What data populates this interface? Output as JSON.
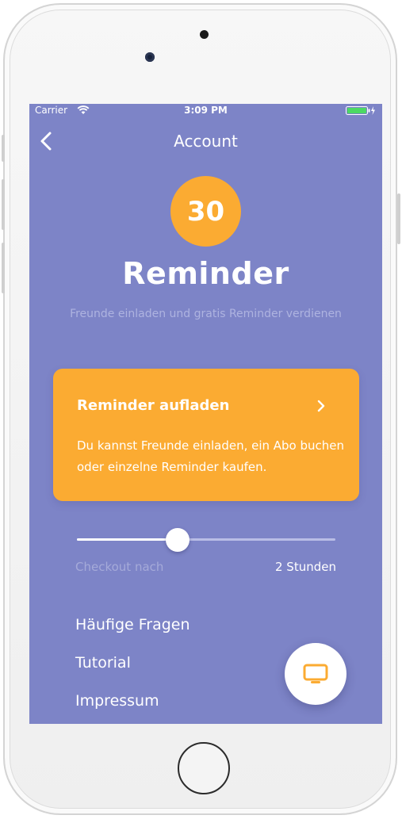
{
  "status_bar": {
    "carrier": "Carrier",
    "time": "3:09 PM"
  },
  "nav": {
    "title": "Account"
  },
  "reminder": {
    "count": "30",
    "title": "Reminder",
    "subtitle": "Freunde einladen und gratis Reminder verdienen"
  },
  "card": {
    "title": "Reminder aufladen",
    "text": "Du kannst Freunde einladen, ein Abo buchen oder einzelne Reminder kaufen."
  },
  "slider": {
    "label": "Checkout nach",
    "value_label": "2 Stunden",
    "fraction": 0.39
  },
  "menu": {
    "items": [
      {
        "label": "Häufige Fragen"
      },
      {
        "label": "Tutorial"
      },
      {
        "label": "Impressum"
      }
    ]
  },
  "icons": {
    "back": "chevron-left-icon",
    "card_chevron": "chevron-right-icon",
    "fab": "tv-icon",
    "wifi": "wifi-icon",
    "battery": "battery-icon"
  },
  "colors": {
    "background": "#7d84c7",
    "accent": "#fbab32",
    "battery": "#4cd964"
  }
}
